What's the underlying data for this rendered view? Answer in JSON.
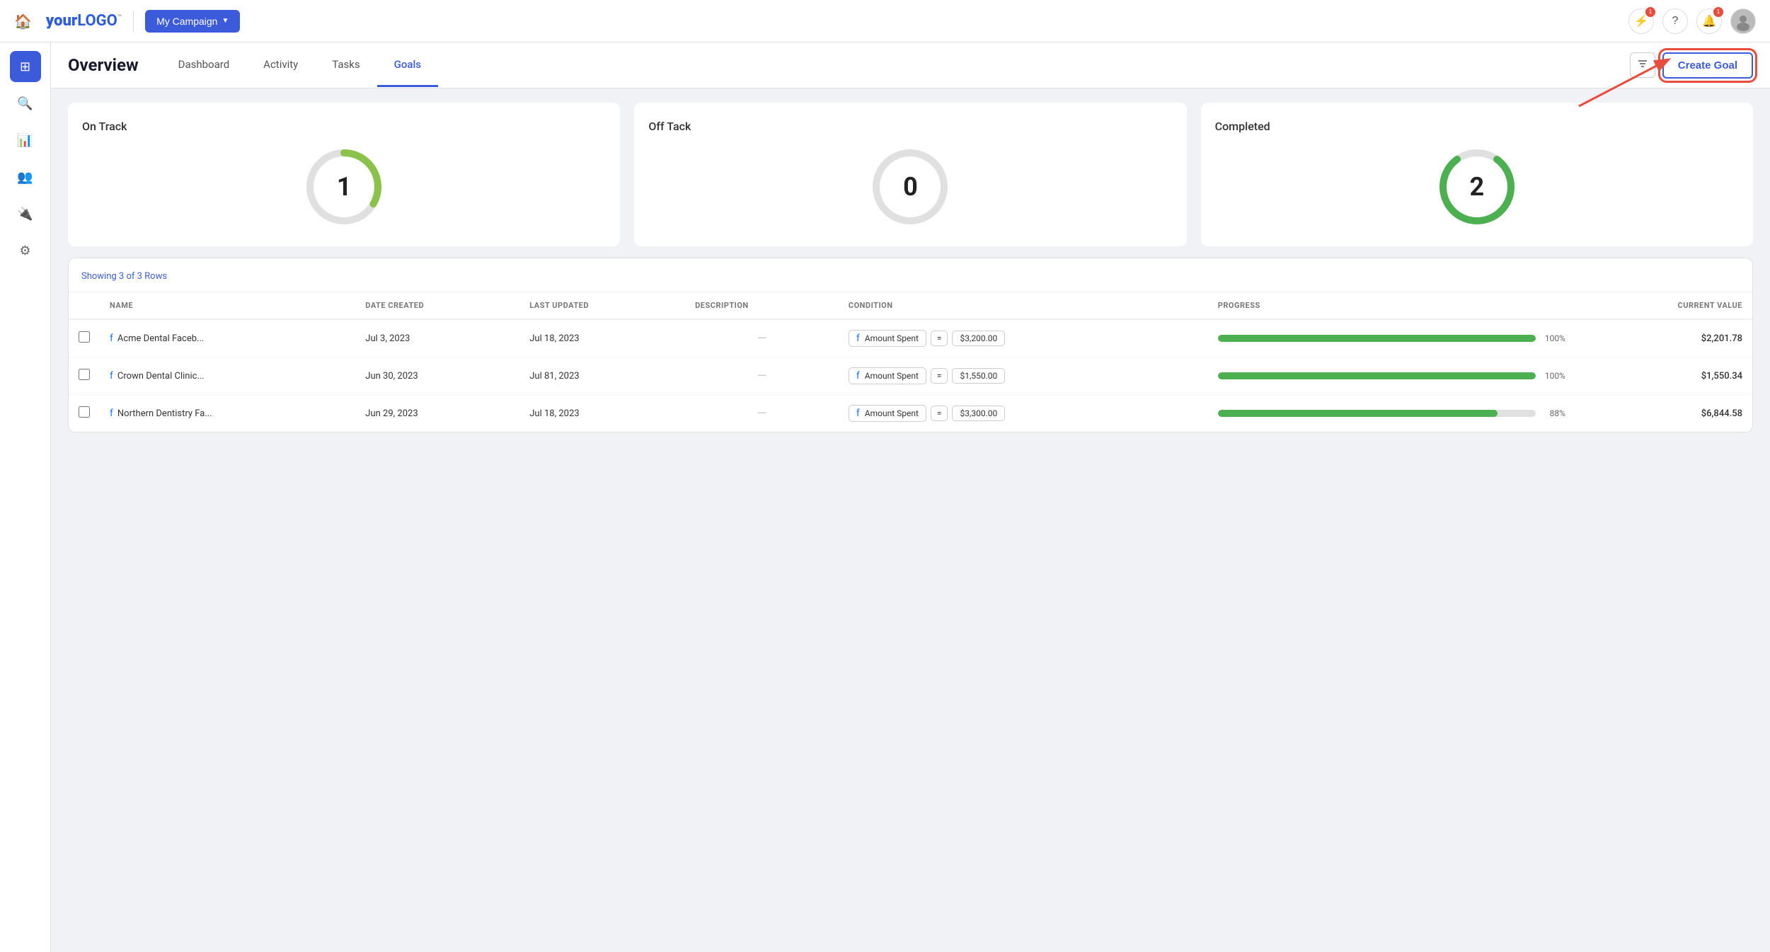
{
  "topNav": {
    "logoText": "your",
    "logoHighlight": "LOGO",
    "logoTM": "™",
    "campaignBtn": "My Campaign",
    "homeIcon": "🏠"
  },
  "navIcons": [
    {
      "name": "lightning-icon",
      "symbol": "⚡",
      "badge": "1"
    },
    {
      "name": "help-icon",
      "symbol": "?",
      "badge": null
    },
    {
      "name": "bell-icon",
      "symbol": "🔔",
      "badge": "1"
    }
  ],
  "sidebar": {
    "items": [
      {
        "name": "grid-icon",
        "symbol": "⊞",
        "active": true
      },
      {
        "name": "search-icon",
        "symbol": "🔍",
        "active": false
      },
      {
        "name": "chart-icon",
        "symbol": "📊",
        "active": false
      },
      {
        "name": "users-icon",
        "symbol": "👥",
        "active": false
      },
      {
        "name": "plugin-icon",
        "symbol": "🔌",
        "active": false
      },
      {
        "name": "settings-icon",
        "symbol": "⚙",
        "active": false
      }
    ]
  },
  "pageHeader": {
    "title": "Overview",
    "tabs": [
      {
        "label": "Dashboard",
        "active": false
      },
      {
        "label": "Activity",
        "active": false
      },
      {
        "label": "Tasks",
        "active": false
      },
      {
        "label": "Goals",
        "active": true
      }
    ],
    "createGoalLabel": "Create Goal"
  },
  "statsCards": [
    {
      "title": "On Track",
      "value": "1",
      "pct": 33,
      "color": "#8bc34a",
      "bgColor": "#e0e0e0"
    },
    {
      "title": "Off Tack",
      "value": "0",
      "pct": 0,
      "color": "#e0e0e0",
      "bgColor": "#e0e0e0"
    },
    {
      "title": "Completed",
      "value": "2",
      "pct": 80,
      "color": "#4caf50",
      "bgColor": "#e0e0e0"
    }
  ],
  "table": {
    "metaText": "Showing 3 of 3 Rows",
    "columns": [
      {
        "label": "NAME"
      },
      {
        "label": "DATE CREATED"
      },
      {
        "label": "LAST UPDATED"
      },
      {
        "label": "DESCRIPTION"
      },
      {
        "label": "CONDITION"
      },
      {
        "label": "PROGRESS"
      },
      {
        "label": "CURRENT VALUE"
      }
    ],
    "rows": [
      {
        "name": "Acme Dental Faceb...",
        "dateCreated": "Jul 3, 2023",
        "lastUpdated": "Jul 18, 2023",
        "description": "—",
        "conditionMetric": "Amount Spent",
        "conditionOp": "=",
        "conditionValue": "$3,200.00",
        "progress": 100,
        "currentValue": "$2,201.78"
      },
      {
        "name": "Crown Dental Clinic...",
        "dateCreated": "Jun 30, 2023",
        "lastUpdated": "Jul 81, 2023",
        "description": "—",
        "conditionMetric": "Amount Spent",
        "conditionOp": "=",
        "conditionValue": "$1,550.00",
        "progress": 100,
        "currentValue": "$1,550.34"
      },
      {
        "name": "Northern Dentistry Fa...",
        "dateCreated": "Jun 29, 2023",
        "lastUpdated": "Jul 18, 2023",
        "description": "—",
        "conditionMetric": "Amount Spent",
        "conditionOp": "=",
        "conditionValue": "$3,300.00",
        "progress": 88,
        "currentValue": "$6,844.58"
      }
    ]
  }
}
